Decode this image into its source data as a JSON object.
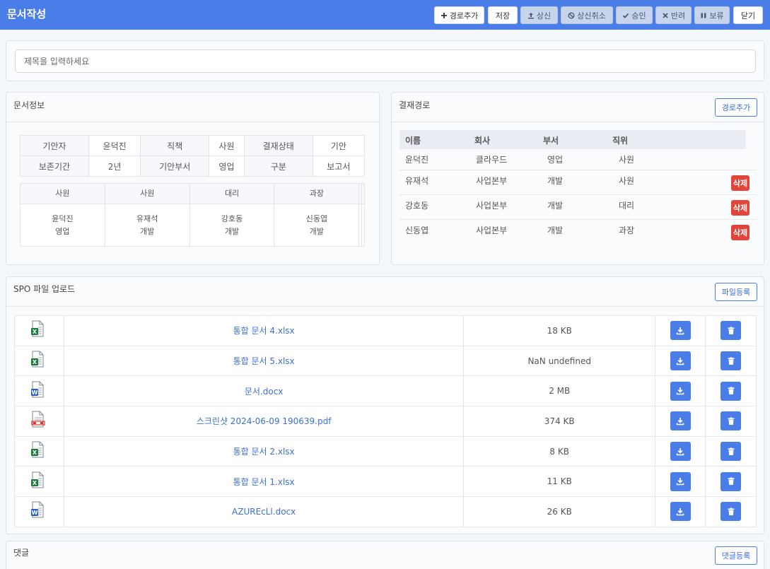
{
  "header": {
    "title": "문서작성",
    "buttons": [
      {
        "label": "경로추가",
        "icon": "plus-icon"
      },
      {
        "label": "저장",
        "icon": ""
      },
      {
        "label": "상신",
        "icon": "upload-icon"
      },
      {
        "label": "상신취소",
        "icon": "ban-icon"
      },
      {
        "label": "승인",
        "icon": "check-icon"
      },
      {
        "label": "반려",
        "icon": "x-icon"
      },
      {
        "label": "보류",
        "icon": "pause-icon"
      },
      {
        "label": "닫기",
        "icon": ""
      }
    ]
  },
  "title_field": {
    "placeholder": "제목을 입력하세요",
    "value": ""
  },
  "doc_info": {
    "heading": "문서정보",
    "rows": [
      [
        "기안자",
        "윤덕진",
        "직책",
        "사원",
        "결재상태",
        "기안"
      ],
      [
        "보존기간",
        "2년",
        "기안부서",
        "영업",
        "구분",
        "보고서"
      ]
    ],
    "approvers": [
      {
        "position": "사원",
        "name": "윤덕진",
        "dept": "영업"
      },
      {
        "position": "사원",
        "name": "유재석",
        "dept": "개발"
      },
      {
        "position": "대리",
        "name": "강호동",
        "dept": "개발"
      },
      {
        "position": "과장",
        "name": "신동엽",
        "dept": "개발"
      },
      {
        "position": "",
        "name": "",
        "dept": ""
      },
      {
        "position": "",
        "name": "",
        "dept": ""
      }
    ]
  },
  "route": {
    "heading": "결재경로",
    "add_label": "경로추가",
    "columns": [
      "이름",
      "회사",
      "부서",
      "직위"
    ],
    "rows": [
      {
        "name": "윤덕진",
        "company": "클라우드",
        "dept": "영업",
        "position": "사원",
        "deletable": false
      },
      {
        "name": "유재석",
        "company": "사업본부",
        "dept": "개발",
        "position": "사원",
        "deletable": true
      },
      {
        "name": "강호동",
        "company": "사업본부",
        "dept": "개발",
        "position": "대리",
        "deletable": true
      },
      {
        "name": "신동엽",
        "company": "사업본부",
        "dept": "개발",
        "position": "과장",
        "deletable": true
      }
    ],
    "delete_label": "삭제"
  },
  "files": {
    "heading": "SPO 파일 업로드",
    "register_label": "파일등록",
    "rows": [
      {
        "type": "xlsx",
        "icon": "excel-file-icon",
        "name": "통합 문서 4.xlsx",
        "size": "18 KB"
      },
      {
        "type": "xlsx",
        "icon": "excel-file-icon",
        "name": "통합 문서 5.xlsx",
        "size": "NaN undefined"
      },
      {
        "type": "docx",
        "icon": "word-file-icon",
        "name": "문서.docx",
        "size": "2 MB"
      },
      {
        "type": "pdf",
        "icon": "pdf-file-icon",
        "name": "스크린샷 2024-06-09 190639.pdf",
        "size": "374 KB"
      },
      {
        "type": "xlsx",
        "icon": "excel-file-icon",
        "name": "통합 문서 2.xlsx",
        "size": "8 KB"
      },
      {
        "type": "xlsx",
        "icon": "excel-file-icon",
        "name": "통합 문서 1.xlsx",
        "size": "11 KB"
      },
      {
        "type": "docx",
        "icon": "word-file-icon",
        "name": "AZUREcLl.docx",
        "size": "26 KB"
      }
    ]
  },
  "comments": {
    "heading": "댓글",
    "register_label": "댓글등록"
  },
  "colors": {
    "accent": "#4a7de8",
    "danger": "#e0443a",
    "excel": "#1f7a3f",
    "word": "#2b5fbd",
    "pdf": "#d9392c"
  }
}
